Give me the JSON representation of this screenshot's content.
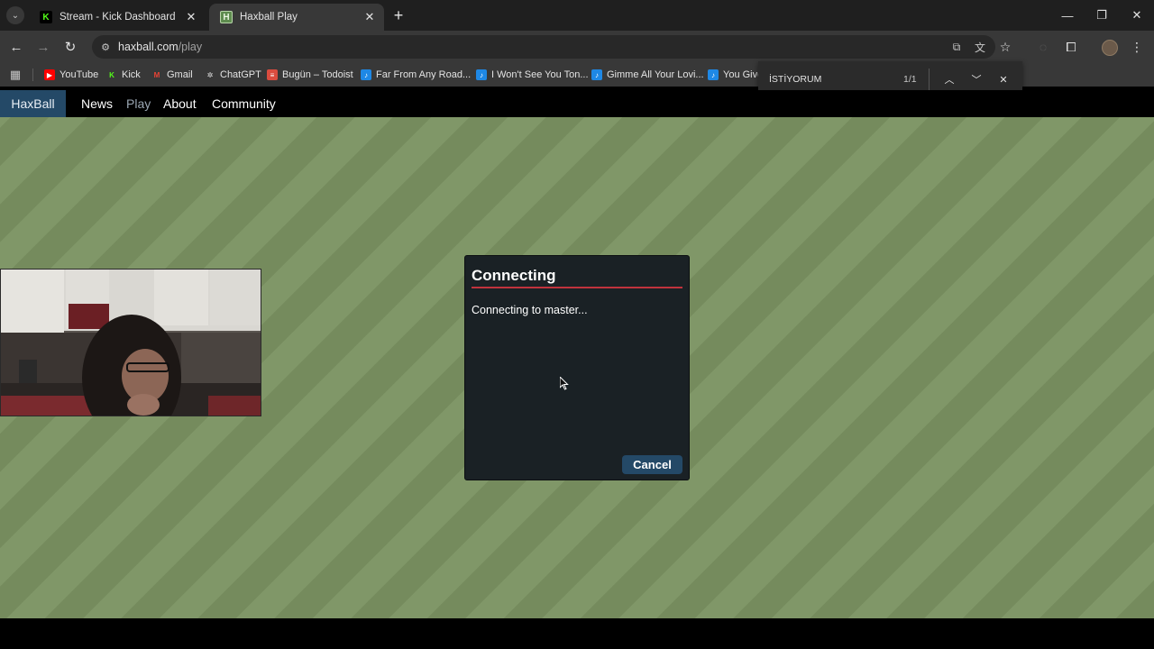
{
  "browser": {
    "tabs": [
      {
        "title": "Stream - Kick Dashboard",
        "favicon": "kick-icon",
        "active": false
      },
      {
        "title": "Haxball Play",
        "favicon": "haxball-icon",
        "active": true
      }
    ],
    "url_host": "haxball.com",
    "url_path": "/play",
    "bookmarks": [
      {
        "label": "YouTube",
        "icon": "youtube-icon"
      },
      {
        "label": "Kick",
        "icon": "kick-icon"
      },
      {
        "label": "Gmail",
        "icon": "gmail-icon"
      },
      {
        "label": "ChatGPT",
        "icon": "chatgpt-icon"
      },
      {
        "label": "Bugün – Todoist",
        "icon": "todoist-icon"
      },
      {
        "label": "Far From Any Road...",
        "icon": "doc-icon"
      },
      {
        "label": "I Won't See You Ton...",
        "icon": "doc-icon"
      },
      {
        "label": "Gimme All Your Lovi...",
        "icon": "doc-icon"
      },
      {
        "label": "You Give",
        "icon": "doc-icon"
      }
    ],
    "find": {
      "query": "İSTİYORUM",
      "count": "1/1"
    }
  },
  "site": {
    "brand": "HaxBall",
    "nav": [
      "News",
      "Play",
      "About",
      "Community"
    ],
    "active_nav": "Play"
  },
  "dialog": {
    "title": "Connecting",
    "message": "Connecting to master...",
    "cancel_label": "Cancel"
  },
  "colors": {
    "field": "#7b9163",
    "dialog_bg": "#1a2125",
    "accent_rule": "#c1333d",
    "button_bg": "#244967"
  }
}
